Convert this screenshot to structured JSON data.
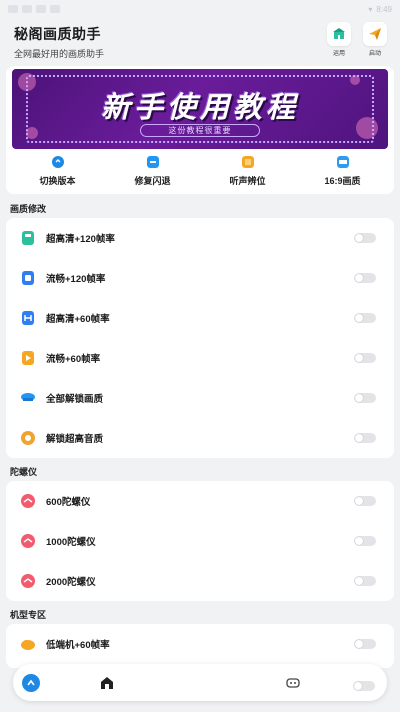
{
  "status_bar": {
    "right_text": "8:49"
  },
  "header": {
    "title": "秘阁画质助手",
    "subtitle": "全网最好用的画质助手",
    "actions": [
      {
        "label": "运用",
        "icon": "building-icon"
      },
      {
        "label": "启动",
        "icon": "send-icon"
      }
    ]
  },
  "banner": {
    "title": "新手使用教程",
    "subtitle": "这份教程很重要"
  },
  "quick_actions": [
    {
      "label": "切换版本",
      "icon": "switch-icon",
      "color": "#1e88e5"
    },
    {
      "label": "修复闪退",
      "icon": "repair-icon",
      "color": "#2196f3"
    },
    {
      "label": "听声辨位",
      "icon": "sound-icon",
      "color": "#f5a623"
    },
    {
      "label": "16:9画质",
      "icon": "aspect-ratio-icon",
      "color": "#2f9bf0"
    }
  ],
  "sections": [
    {
      "title": "画质修改",
      "items": [
        {
          "label": "超高清+120帧率",
          "icon": "hd-icon",
          "color": "#2bbf9e"
        },
        {
          "label": "流畅+120帧率",
          "icon": "flow-icon",
          "color": "#2f7ff2"
        },
        {
          "label": "超高清+60帧率",
          "icon": "wide-icon",
          "color": "#2f7ff2"
        },
        {
          "label": "流畅+60帧率",
          "icon": "play-icon",
          "color": "#f5a623"
        },
        {
          "label": "全部解锁画质",
          "icon": "unlock-icon",
          "color": "#2196f3"
        },
        {
          "label": "解锁超高音质",
          "icon": "audio-icon",
          "color": "#f0a330"
        }
      ]
    },
    {
      "title": "陀螺仪",
      "items": [
        {
          "label": "600陀螺仪",
          "icon": "gyro-icon",
          "color": "#f25a6f"
        },
        {
          "label": "1000陀螺仪",
          "icon": "gyro-icon",
          "color": "#f25a6f"
        },
        {
          "label": "2000陀螺仪",
          "icon": "gyro-icon",
          "color": "#f25a6f"
        }
      ]
    },
    {
      "title": "机型专区",
      "items": [
        {
          "label": "低端机+60帧率",
          "icon": "cloud-icon",
          "color": "#f5a623"
        }
      ]
    }
  ],
  "bottom_nav": {
    "items": [
      {
        "icon": "home-icon"
      },
      {
        "icon": "gamepad-icon"
      }
    ]
  }
}
